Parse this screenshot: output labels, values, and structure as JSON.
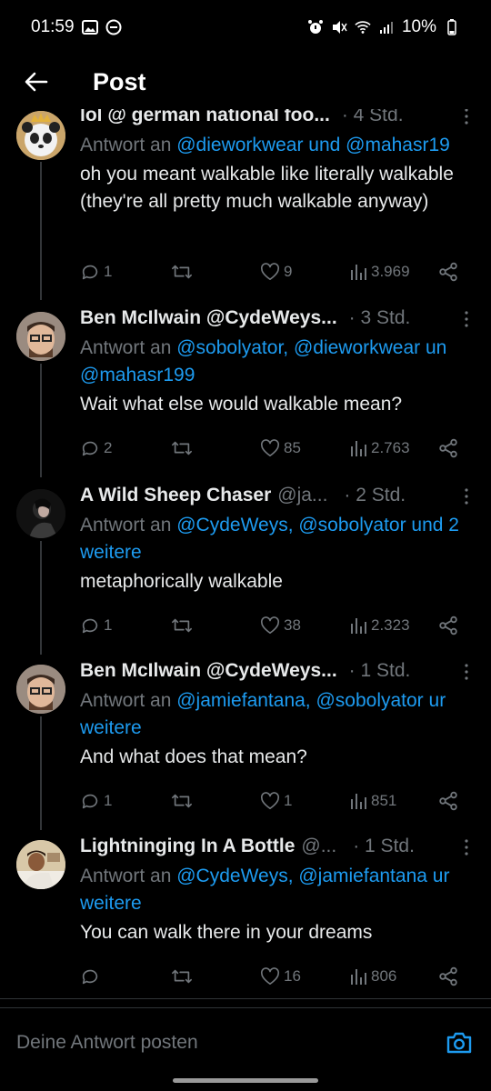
{
  "status": {
    "time": "01:59",
    "battery": "10%"
  },
  "header": {
    "title": "Post"
  },
  "tweets": [
    {
      "name": "lol @ german national foo...",
      "handle": "",
      "time": "· 4 Std.",
      "reply_prefix": "Antwort an ",
      "reply_mentions_1": "@dieworkwear und @mahasr19",
      "reply_mentions_2": "",
      "text": "oh you meant walkable like literally walkable (they're all pretty much walkable anyway)",
      "replies": "1",
      "retweets": "",
      "likes": "9",
      "views": "3.969"
    },
    {
      "name": "Ben McIlwain @CydeWeys...",
      "handle": "",
      "time": "· 3 Std.",
      "reply_prefix": "Antwort an ",
      "reply_mentions_1": "@sobolyator, @dieworkwear un",
      "reply_mentions_2": "@mahasr199",
      "text": "Wait what else would walkable mean?",
      "replies": "2",
      "retweets": "",
      "likes": "85",
      "views": "2.763"
    },
    {
      "name": "A Wild Sheep Chaser",
      "handle": "@ja...",
      "time": "· 2 Std.",
      "reply_prefix": "Antwort an ",
      "reply_mentions_1": "@CydeWeys, @sobolyator und 2",
      "reply_mentions_2": "weitere",
      "text": "metaphorically walkable",
      "replies": "1",
      "retweets": "",
      "likes": "38",
      "views": "2.323"
    },
    {
      "name": "Ben McIlwain @CydeWeys...",
      "handle": "",
      "time": "· 1 Std.",
      "reply_prefix": "Antwort an ",
      "reply_mentions_1": "@jamiefantana, @sobolyator ur",
      "reply_mentions_2": "weitere",
      "text": "And what does that mean?",
      "replies": "1",
      "retweets": "",
      "likes": "1",
      "views": "851"
    },
    {
      "name": "Lightninging In A Bottle",
      "handle": "@...",
      "time": "· 1 Std.",
      "reply_prefix": "Antwort an ",
      "reply_mentions_1": "@CydeWeys, @jamiefantana ur",
      "reply_mentions_2": "weitere",
      "text": "You can walk there in your dreams",
      "replies": "",
      "retweets": "",
      "likes": "16",
      "views": "806"
    }
  ],
  "reply_bar": {
    "placeholder": "Deine Antwort posten"
  },
  "colors": {
    "accent": "#1d9bf0",
    "muted": "#71767b",
    "text": "#e7e9ea",
    "background": "#000000"
  }
}
